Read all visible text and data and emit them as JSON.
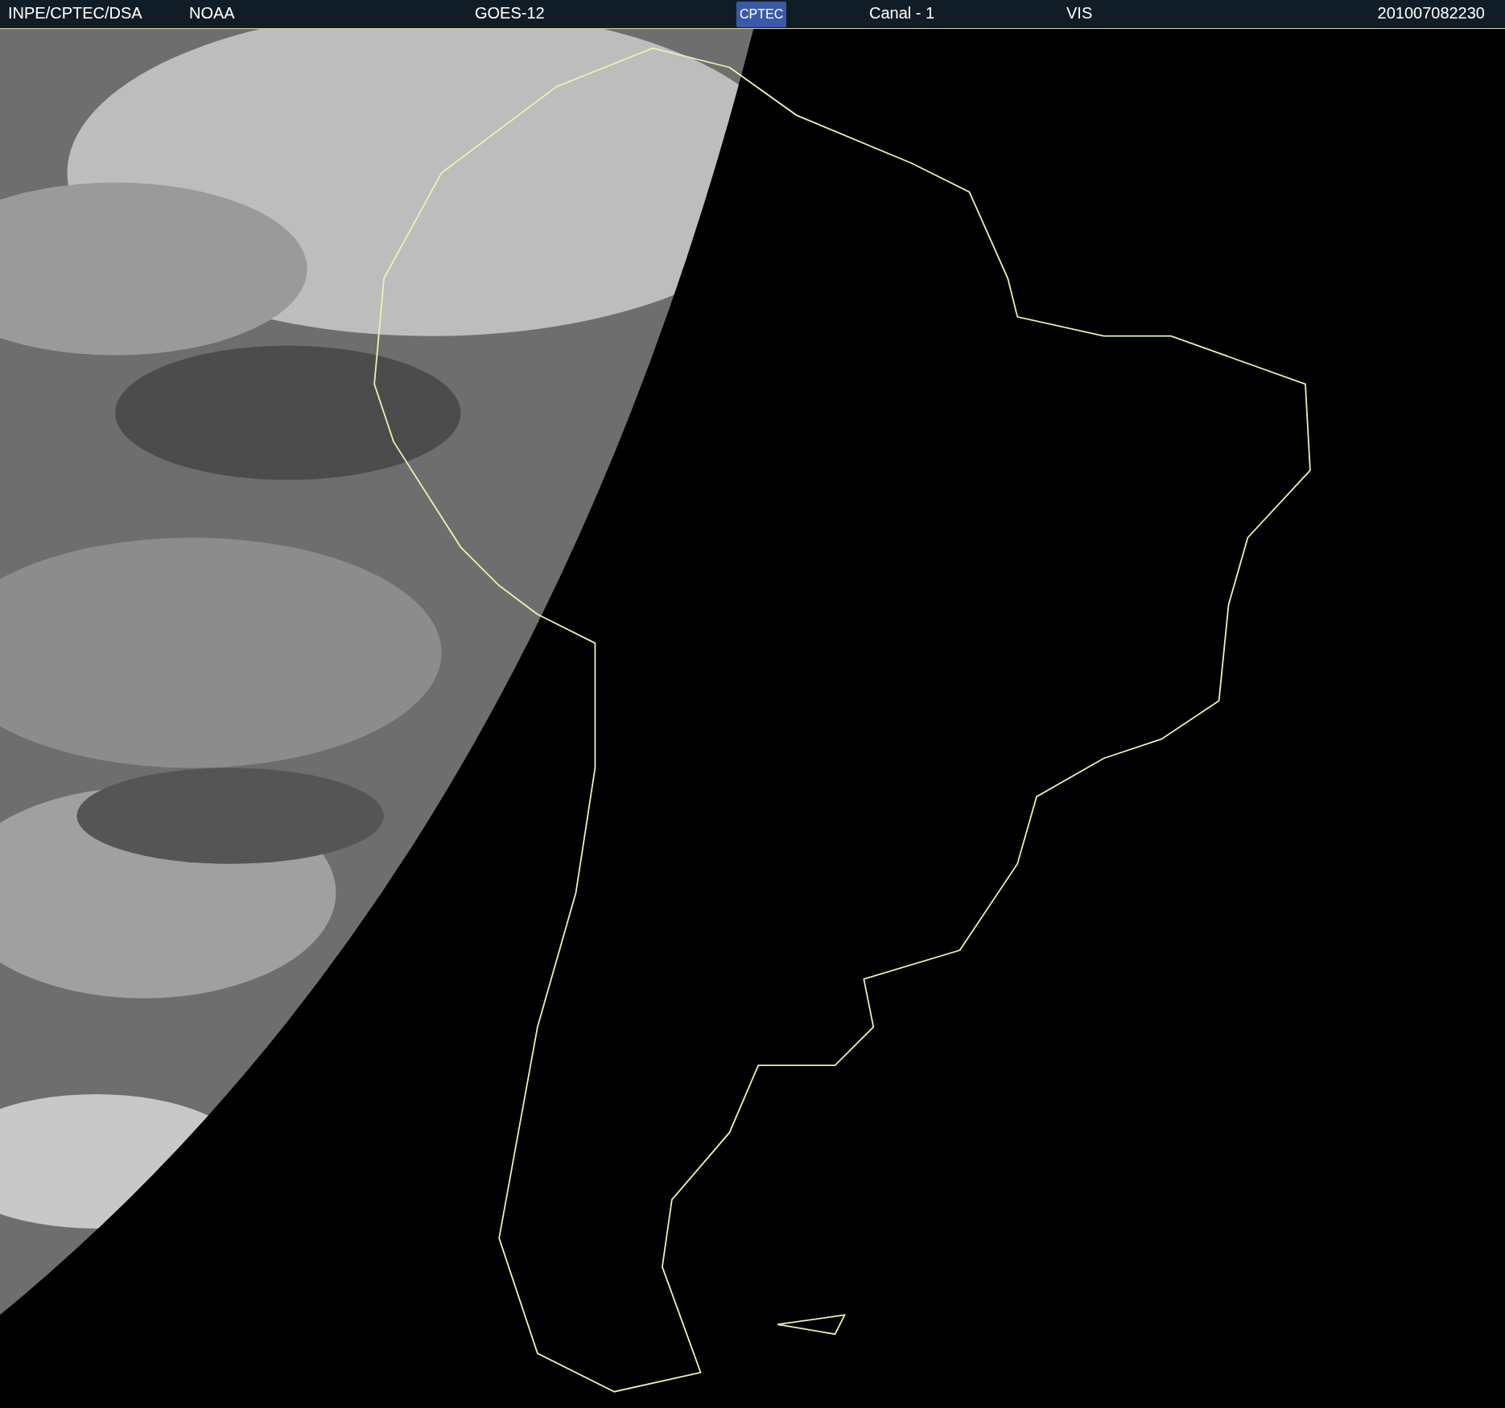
{
  "header": {
    "source": "INPE/CPTEC/DSA",
    "agency": "NOAA",
    "satellite": "GOES-12",
    "logo": "CPTEC",
    "channel": "Canal - 1",
    "band": "VIS",
    "timestamp": "201007082230"
  }
}
